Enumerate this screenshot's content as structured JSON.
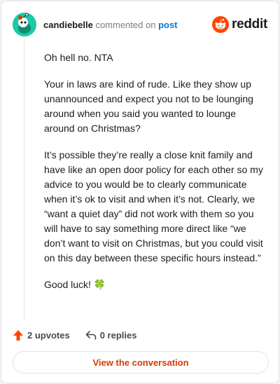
{
  "header": {
    "username": "candiebelle",
    "action_text": "commented on",
    "target_link": "post",
    "logo_text": "reddit",
    "avatar_icon": "snoo-avatar-icon",
    "logo_icon": "reddit-snoo-icon"
  },
  "comment": {
    "paragraphs": [
      "Oh hell no. NTA",
      "Your in laws are kind of rude. Like they show up unannounced and expect you not to be lounging around when you said you wanted to lounge around on Christmas?",
      "It’s possible they’re really a close knit family and have like an open door policy for each other so my advice to you would be to clearly communicate when it’s ok to visit and when it’s not. Clearly, we “want a quiet day” did not work with them so you will have to say something more direct like “we don’t want to visit on Christmas, but you could visit on this day between these specific hours instead.”",
      "Good luck!"
    ],
    "emoji": "🍀"
  },
  "actions": {
    "upvotes": "2 upvotes",
    "replies": "0 replies",
    "upvote_icon": "upvote-arrow-icon",
    "reply_icon": "reply-arrow-icon"
  },
  "footer": {
    "view_label": "View the conversation"
  },
  "colors": {
    "accent": "#d93a00",
    "link": "#0079d3",
    "avatar_bg": "#1ec9a4",
    "reddit_orange": "#ff4500"
  }
}
